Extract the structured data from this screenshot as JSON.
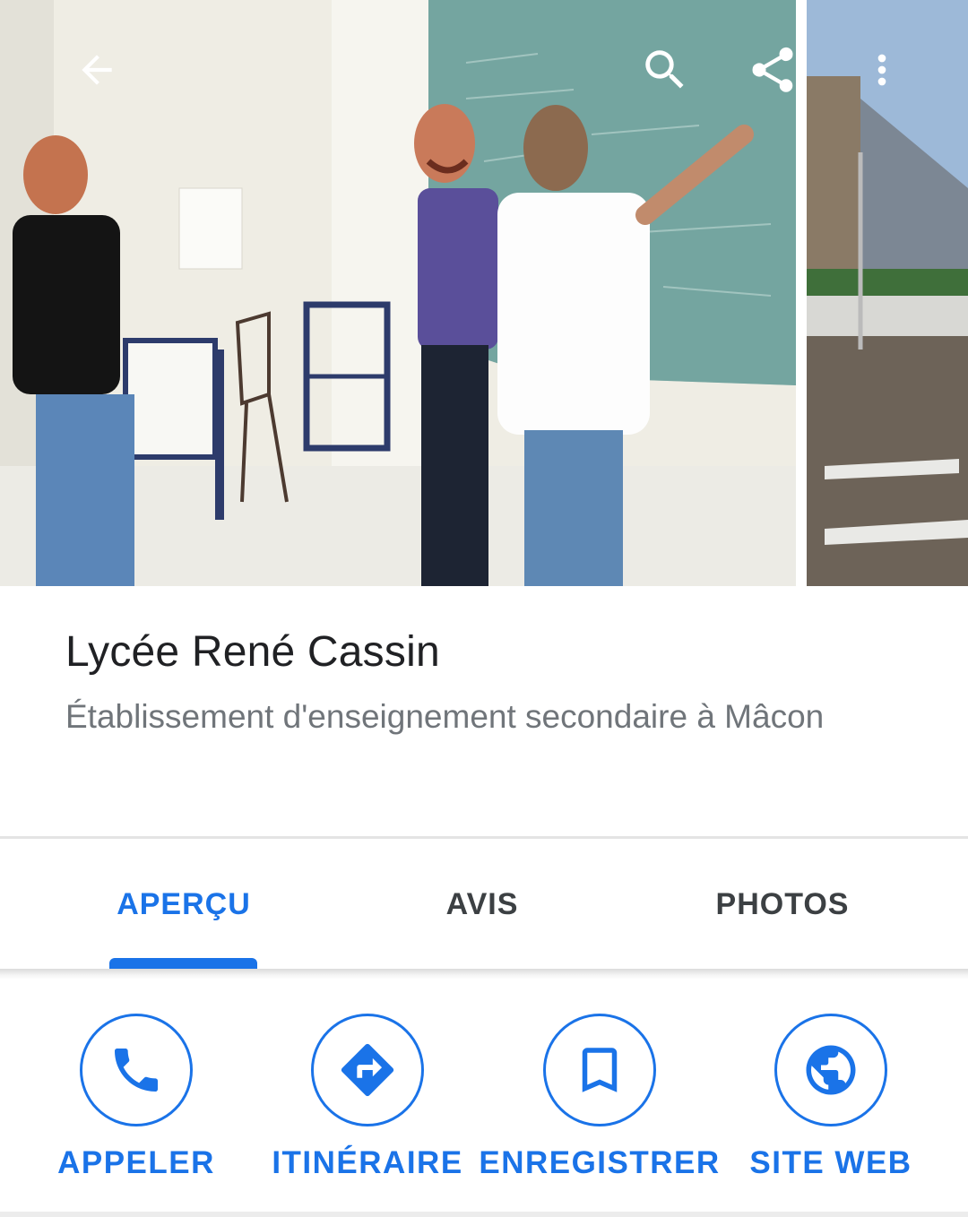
{
  "header": {
    "back_icon": "arrow-back-icon",
    "search_icon": "search-icon",
    "share_icon": "share-icon",
    "more_icon": "more-vert-icon"
  },
  "place": {
    "name": "Lycée René Cassin",
    "category": "Établissement d'enseignement secondaire à Mâcon"
  },
  "tabs": [
    {
      "label": "APERÇU",
      "active": true
    },
    {
      "label": "AVIS",
      "active": false
    },
    {
      "label": "PHOTOS",
      "active": false
    }
  ],
  "actions": [
    {
      "label": "APPELER",
      "icon": "phone-icon"
    },
    {
      "label": "ITINÉRAIRE",
      "icon": "directions-icon"
    },
    {
      "label": "ENREGISTRER",
      "icon": "bookmark-icon"
    },
    {
      "label": "SITE WEB",
      "icon": "globe-icon"
    }
  ],
  "colors": {
    "accent": "#1a73e8",
    "title": "#202124",
    "subtitle": "#70757a",
    "tab_inactive": "#3c4043"
  }
}
